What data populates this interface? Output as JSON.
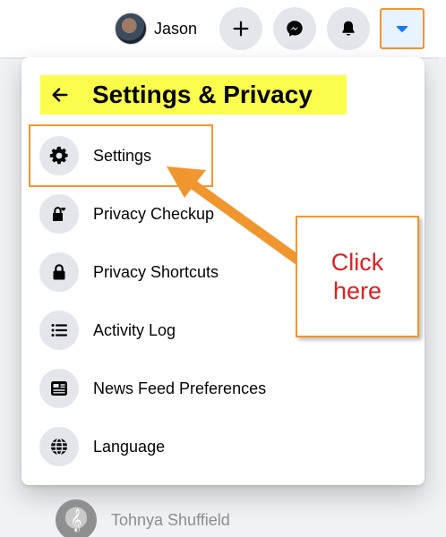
{
  "topbar": {
    "profile_name": "Jason",
    "buttons": [
      {
        "name": "create",
        "icon": "plus-icon"
      },
      {
        "name": "messenger",
        "icon": "messenger-icon"
      },
      {
        "name": "notifications",
        "icon": "bell-icon"
      },
      {
        "name": "account",
        "icon": "caret-down-icon",
        "accent": "#1877f2"
      }
    ]
  },
  "panel": {
    "title": "Settings & Privacy",
    "back_icon": "arrow-left-icon",
    "items": [
      {
        "label": "Settings",
        "icon": "gear-icon"
      },
      {
        "label": "Privacy Checkup",
        "icon": "lock-heart-icon"
      },
      {
        "label": "Privacy Shortcuts",
        "icon": "lock-icon"
      },
      {
        "label": "Activity Log",
        "icon": "list-icon"
      },
      {
        "label": "News Feed Preferences",
        "icon": "feed-icon"
      },
      {
        "label": "Language",
        "icon": "globe-icon"
      }
    ]
  },
  "callout": {
    "text_line1": "Click",
    "text_line2": "here"
  },
  "contact": {
    "name": "Tohnya Shuffield",
    "avatar_glyph": "𝄞"
  },
  "colors": {
    "annotation_orange": "#f0962f",
    "header_highlight": "#fbfd4d",
    "callout_text": "#e02020",
    "icon_bg": "#e4e6eb"
  }
}
